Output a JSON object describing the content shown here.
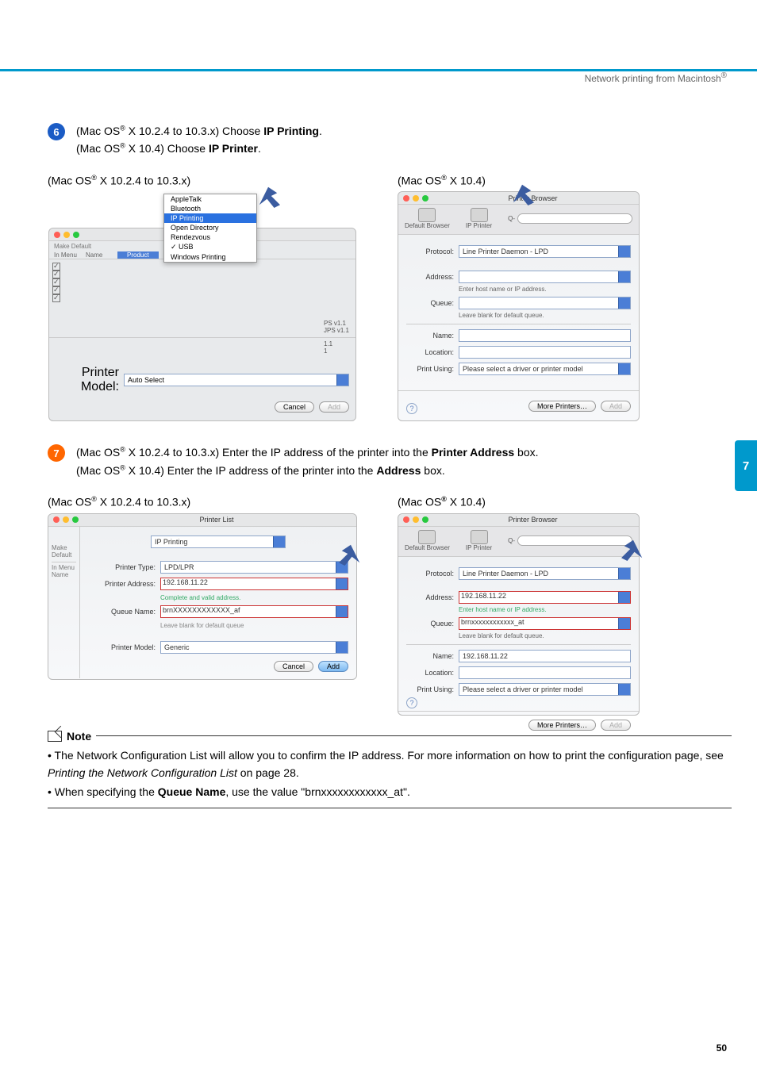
{
  "header_right": "Network printing from Macintosh",
  "steps": {
    "s6": {
      "num": "6",
      "l1a": "(Mac OS",
      "l1b": " X 10.2.4 to 10.3.x) Choose ",
      "l1c": "IP Printing",
      "l1d": ".",
      "l2a": "(Mac OS",
      "l2b": " X 10.4) Choose ",
      "l2c": "IP Printer",
      "l2d": "."
    },
    "s7": {
      "num": "7",
      "l1a": "(Mac OS",
      "l1b": " X 10.2.4 to 10.3.x) Enter the IP address of the printer into the ",
      "l1c": "Printer Address",
      "l1d": " box.",
      "l2a": "(Mac OS",
      "l2b": " X 10.4) Enter the IP address of the printer into the ",
      "l2c": "Address",
      "l2d": " box."
    }
  },
  "col_labels": {
    "left_a": "(Mac OS",
    "left_b": " X 10.2.4 to 10.3.x)",
    "right_a": "(Mac OS",
    "right_b": " X 10.4)"
  },
  "shot1": {
    "menu": [
      "AppleTalk",
      "Bluetooth",
      "IP Printing",
      "Open Directory",
      "Rendezvous",
      "USB",
      "Windows Printing"
    ],
    "make_default": "Make Default",
    "in_menu": "In Menu",
    "name": "Name",
    "product": "Product",
    "col_frag": [
      "PS v1.1",
      "JPS v1.1",
      "1.1",
      "1"
    ],
    "pm_label": "Printer Model:",
    "pm_val": "Auto Select",
    "cancel": "Cancel",
    "add": "Add"
  },
  "shot2": {
    "title": "Printer Browser",
    "tb": {
      "db": "Default Browser",
      "ip": "IP Printer",
      "search": "Search",
      "q": "Q-"
    },
    "protocol_l": "Protocol:",
    "protocol_v": "Line Printer Daemon - LPD",
    "address_l": "Address:",
    "address_h": "Enter host name or IP address.",
    "queue_l": "Queue:",
    "queue_h": "Leave blank for default queue.",
    "name_l": "Name:",
    "loc_l": "Location:",
    "pu_l": "Print Using:",
    "pu_v": "Please select a driver or printer model",
    "more": "More Printers…",
    "add": "Add"
  },
  "shot3": {
    "title": "Printer List",
    "make_default": "Make Default",
    "in_menu": "In Menu",
    "name": "Name",
    "top_sel": "IP Printing",
    "pt_l": "Printer Type:",
    "pt_v": "LPD/LPR",
    "pa_l": "Printer Address:",
    "pa_v": "192.168.11.22",
    "pa_h": "Complete and valid address.",
    "qn_l": "Queue Name:",
    "qn_v": "brnXXXXXXXXXXXX_af",
    "qn_h": "Leave blank for default queue",
    "pm_l": "Printer Model:",
    "pm_v": "Generic",
    "cancel": "Cancel",
    "add": "Add"
  },
  "shot4": {
    "title": "Printer Browser",
    "tb": {
      "db": "Default Browser",
      "ip": "IP Printer",
      "search": "Search",
      "q": "Q-"
    },
    "protocol_l": "Protocol:",
    "protocol_v": "Line Printer Daemon - LPD",
    "address_l": "Address:",
    "address_v": "192.168.11.22",
    "address_h": "Enter host name or IP address.",
    "queue_l": "Queue:",
    "queue_v": "brnxxxxxxxxxxxx_at",
    "queue_h": "Leave blank for default queue.",
    "name_l": "Name:",
    "name_v": "192.168.11.22",
    "loc_l": "Location:",
    "pu_l": "Print Using:",
    "pu_v": "Please select a driver or printer model",
    "more": "More Printers…",
    "add": "Add"
  },
  "note": {
    "title": "Note",
    "n1a": "The Network Configuration List will allow you to confirm the IP address. For more information on how to print the configuration page, see ",
    "n1b": "Printing the Network Configuration List",
    "n1c": " on page 28.",
    "n2a": "When specifying the ",
    "n2b": "Queue Name",
    "n2c": ", use the value \"brnxxxxxxxxxxxx_at\"."
  },
  "tab7": "7",
  "page_num": "50",
  "reg": "®"
}
